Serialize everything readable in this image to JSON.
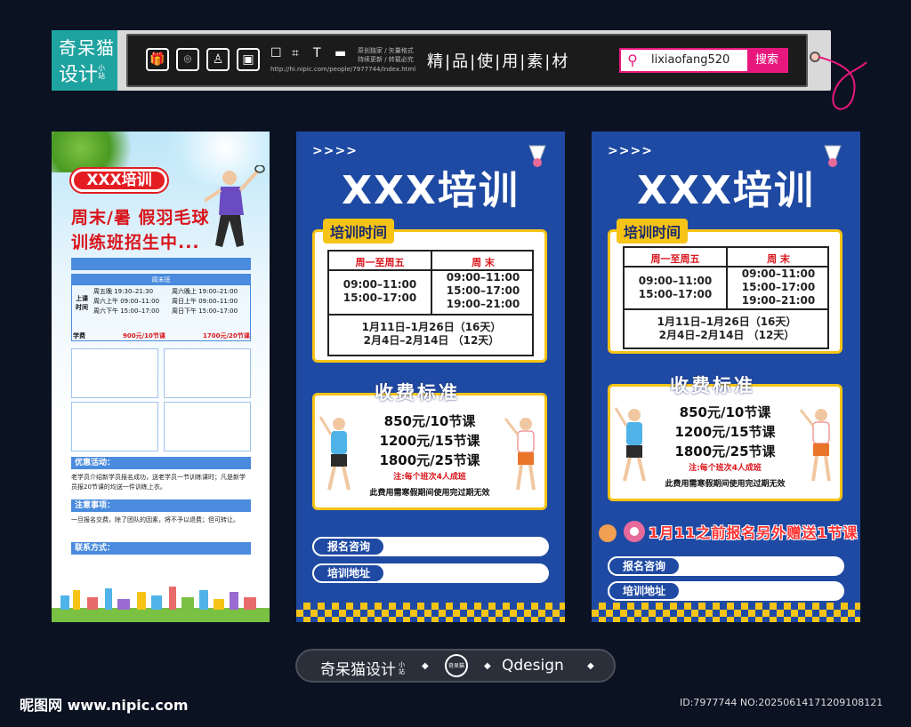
{
  "header": {
    "logo_line1": "奇呆猫",
    "logo_line2": "设计",
    "logo_small": "小站",
    "tool_icons": [
      "gift-icon",
      "camera-icon",
      "dress-icon",
      "bag-icon"
    ],
    "tools": [
      "☐",
      "⌗",
      "T",
      "▬"
    ],
    "url": "http://hi.nipic.com/people/7977744/index.html",
    "line_a": "原创独家 / 矢量格式",
    "line_b": "持续更新 / 转载必究",
    "slogan": "精|品|使|用|素|材",
    "search_value": "lixiaofang520",
    "search_button": "搜索"
  },
  "poster_left": {
    "badge": "XXX培训",
    "line1": "周末/暑 假羽毛球",
    "line2": "训练班招生中...",
    "table_header": "周末班",
    "side_label": "上课时间",
    "rows_left": [
      "周五晚  19:30–21:30",
      "周六上午 09:00–11:00",
      "周六下午 15:00–17:00"
    ],
    "rows_right": [
      "周六晚上 19:00–21:00",
      "周日上午 09:00–11:00",
      "周日下午 15:00–17:00"
    ],
    "fee_label": "学费",
    "fee_a": "900元/10节课",
    "fee_b": "1700元/20节课",
    "sec1": "优惠活动：",
    "sec1_text": "老学员介绍新学员报名成功，送老学员一节训练课时；凡是新学员报20节课的均送一件训练上衣。",
    "sec2": "注意事项：",
    "sec2_text": "一旦报名交费，除了团队的因素，将不予以退费；但可转让。",
    "sec3": "联系方式："
  },
  "poster_blue": {
    "arrows": ">>>>",
    "title": "XXX培训",
    "time_label": "培训时间",
    "col1_head": "周一至周五",
    "col2_head": "周  末",
    "col1_times": [
      "09:00–11:00",
      "15:00–17:00"
    ],
    "col2_times": [
      "09:00–11:00",
      "15:00–17:00",
      "19:00–21:00"
    ],
    "date1": "1月11日–1月26日（16天）",
    "date2": "2月4日–2月14日  （12天）",
    "fee_title": "收费标准",
    "fees": [
      "850元/10节课",
      "1200元/15节课",
      "1800元/25节课"
    ],
    "note": "注:每个班次4人成班",
    "note2": "此费用需寒假期间使用完过期无效",
    "consult": "报名咨询",
    "address": "培训地址",
    "promo": "1月11之前报名另外赠送1节课"
  },
  "footer": {
    "brand": "奇呆猫设计",
    "brand_small": "小站",
    "seal": "奇呆猫",
    "right": "Qdesign"
  },
  "watermark": {
    "left": "昵图网 www.nipic.com",
    "right": "ID:7977744 NO:20250614171209108121"
  }
}
